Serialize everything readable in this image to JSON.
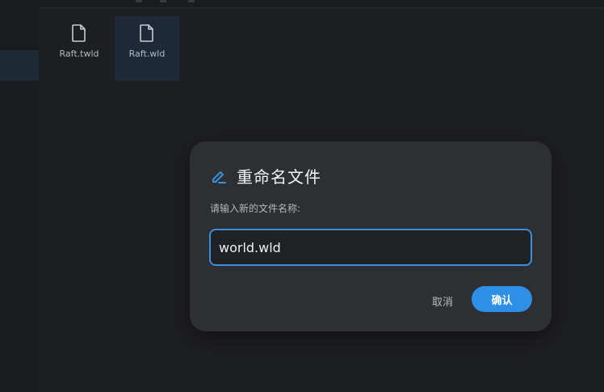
{
  "files": [
    {
      "name": "Raft.twld",
      "icon": "file-icon",
      "selected": false
    },
    {
      "name": "Raft.wld",
      "icon": "file-icon",
      "selected": true
    }
  ],
  "rename_dialog": {
    "icon": "pencil-icon",
    "title": "重命名文件",
    "prompt": "请输入新的文件名称:",
    "input_value": "world.wld",
    "cancel_label": "取消",
    "confirm_label": "确认"
  },
  "colors": {
    "accent": "#2d8fe6",
    "dialog_bg": "#2e2f33",
    "page_bg": "#1e1f22"
  }
}
